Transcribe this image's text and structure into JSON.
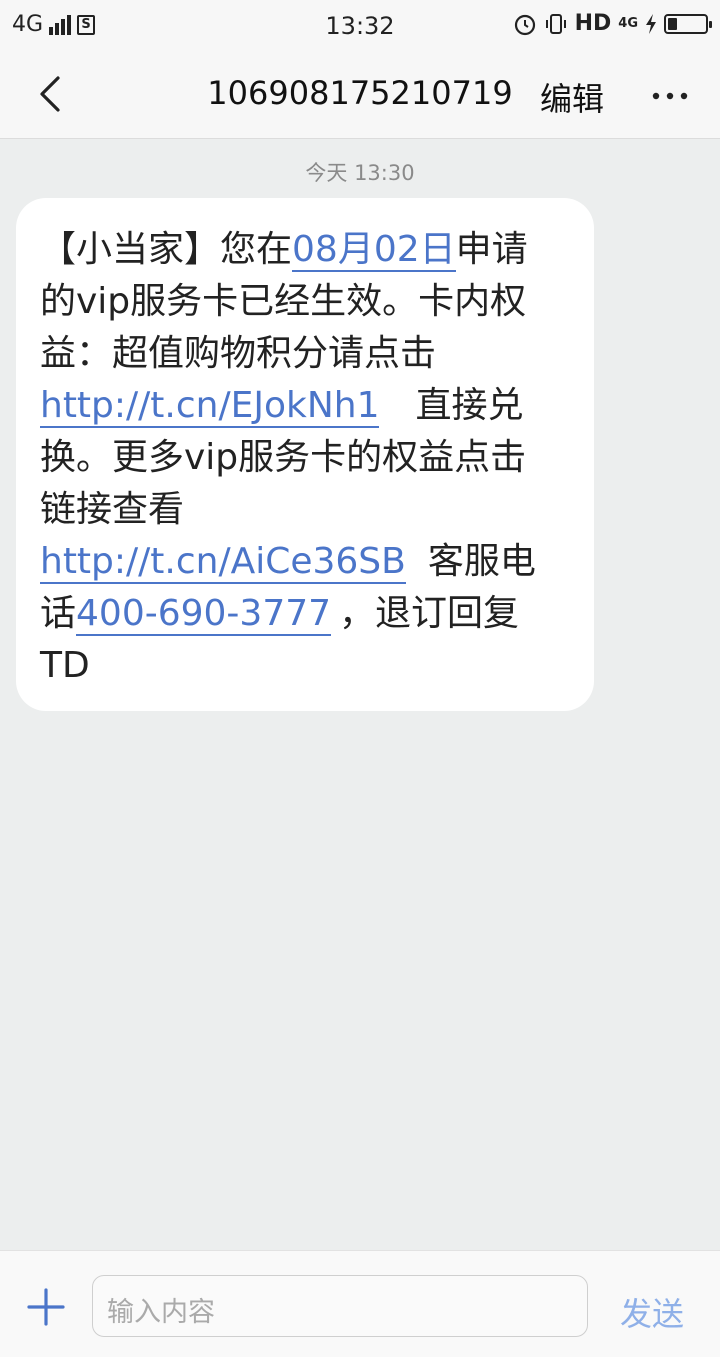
{
  "status": {
    "network": "4G",
    "sim": "S",
    "time": "13:32",
    "hd": "HD",
    "net2": "4G",
    "battery_level": 0.25
  },
  "header": {
    "title": "106908175210719",
    "edit_label": "编辑"
  },
  "conversation": {
    "date_stamp": "今天 13:30",
    "message": {
      "l1_a": "【小当家】您在",
      "l1_date": "08月02日",
      "l1_b": "申请",
      "l2": "的vip服务卡已经生效。卡内权",
      "l3": "益：超值购物积分请点击",
      "l4_link": "http://t.cn/EJokNh1",
      "l4_b": "直接兑",
      "l5": "换。更多vip服务卡的权益点击",
      "l6": "链接查看",
      "l7_link": "http://t.cn/AiCe36SB",
      "l7_b": "客服电",
      "l8_a": "话",
      "l8_phone": "400-690-3777",
      "l8_b": "，退订回复",
      "l9": "TD"
    }
  },
  "composer": {
    "placeholder": "输入内容",
    "send_label": "发送"
  },
  "colors": {
    "link": "#4b75c9",
    "send": "#8fb0e8",
    "background": "#eceeee"
  }
}
